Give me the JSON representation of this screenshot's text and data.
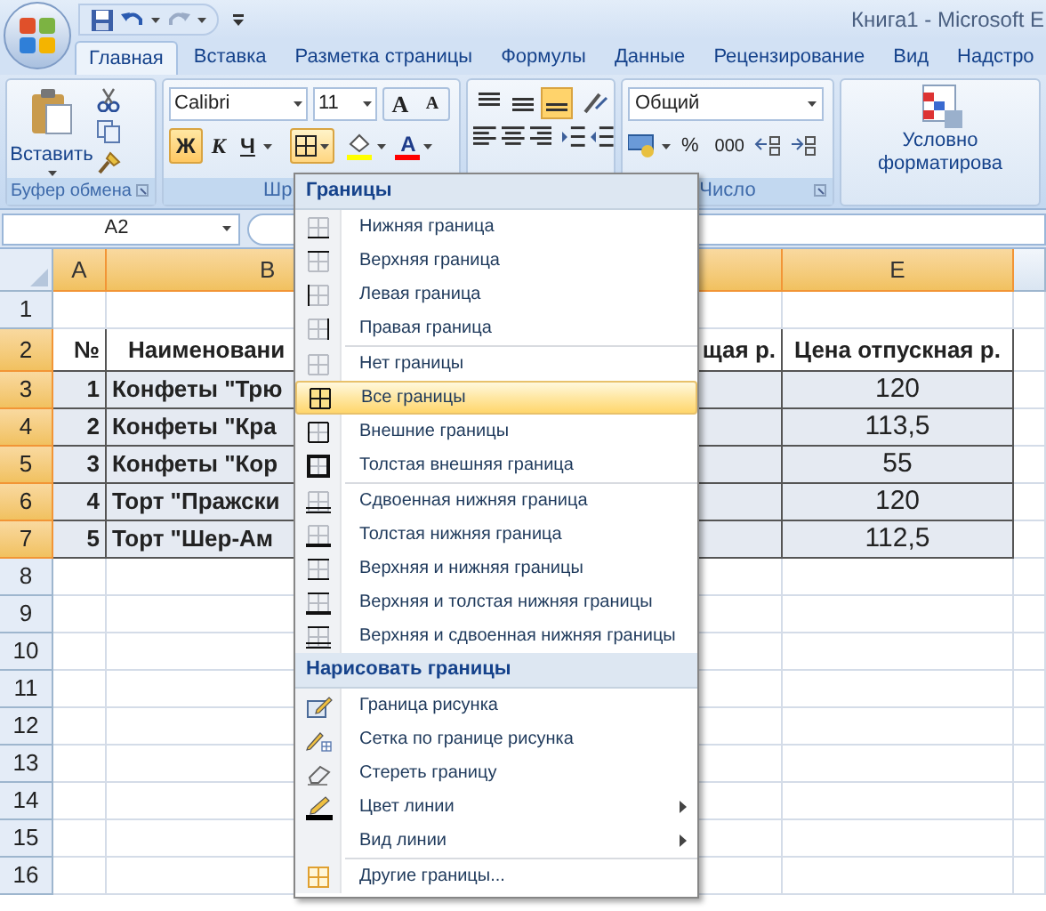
{
  "window": {
    "title": "Книга1 - Microsoft E"
  },
  "tabs": [
    {
      "label": "Главная",
      "selected": true
    },
    {
      "label": "Вставка",
      "selected": false
    },
    {
      "label": "Разметка страницы",
      "selected": false
    },
    {
      "label": "Формулы",
      "selected": false
    },
    {
      "label": "Данные",
      "selected": false
    },
    {
      "label": "Рецензирование",
      "selected": false
    },
    {
      "label": "Вид",
      "selected": false
    },
    {
      "label": "Надстро",
      "selected": false
    }
  ],
  "ribbon": {
    "clipboard": {
      "paste_label": "Вставить",
      "group_label": "Буфер обмена"
    },
    "font": {
      "font_name": "Calibri",
      "font_size": "11",
      "grow_font": "A",
      "shrink_font": "A",
      "bold": {
        "label": "Ж",
        "selected": true
      },
      "italic": {
        "label": "К",
        "selected": false
      },
      "underline": {
        "label": "Ч",
        "selected": false
      },
      "borders": {
        "selected": true
      },
      "font_color": "A",
      "group_label": "Шр"
    },
    "alignment": {
      "bottom_align": {
        "selected": true
      }
    },
    "number": {
      "format": "Общий",
      "percent": "%",
      "thousands": "000",
      "group_label": "Число"
    },
    "styles": {
      "conditional_label": "Условно",
      "conditional_label_2": "форматирова"
    }
  },
  "formula_bar": {
    "name_box": "A2"
  },
  "sheet": {
    "columns": [
      {
        "label": "A",
        "selected": true
      },
      {
        "label": "B",
        "selected": true
      },
      {
        "selected": true
      },
      {
        "label": "E",
        "selected": true
      },
      {
        "selected": false
      }
    ],
    "rows": [
      {
        "label": "1",
        "selected": false,
        "cells": []
      },
      {
        "label": "2",
        "selected": true,
        "cells": [
          "№",
          "Наименовани",
          "щая р.",
          "Цена отпускная р."
        ]
      },
      {
        "label": "3",
        "selected": true,
        "cells": [
          "1",
          "Конфеты \"Трю",
          "",
          "120"
        ]
      },
      {
        "label": "4",
        "selected": true,
        "cells": [
          "2",
          "Конфеты \"Кра",
          "",
          "113,5"
        ]
      },
      {
        "label": "5",
        "selected": true,
        "cells": [
          "3",
          "Конфеты \"Кор",
          "",
          "55"
        ]
      },
      {
        "label": "6",
        "selected": true,
        "cells": [
          "4",
          "Торт \"Пражски",
          "",
          "120"
        ]
      },
      {
        "label": "7",
        "selected": true,
        "cells": [
          "5",
          "Торт \"Шер-Ам",
          "",
          "112,5"
        ]
      },
      {
        "label": "8",
        "selected": false,
        "cells": []
      },
      {
        "label": "9",
        "selected": false,
        "cells": []
      },
      {
        "label": "10",
        "selected": false,
        "cells": []
      },
      {
        "label": "11",
        "selected": false,
        "cells": []
      },
      {
        "label": "12",
        "selected": false,
        "cells": []
      },
      {
        "label": "13",
        "selected": false,
        "cells": []
      },
      {
        "label": "14",
        "selected": false,
        "cells": []
      },
      {
        "label": "15",
        "selected": false,
        "cells": []
      },
      {
        "label": "16",
        "selected": false,
        "cells": []
      }
    ]
  },
  "borders_menu": {
    "sections": [
      {
        "title": "Границы",
        "groups": [
          [
            {
              "label": "Нижняя граница",
              "selected": false
            },
            {
              "label": "Верхняя граница",
              "selected": false
            },
            {
              "label": "Левая граница",
              "selected": false
            },
            {
              "label": "Правая граница",
              "selected": false
            }
          ],
          [
            {
              "label": "Нет границы",
              "selected": false
            },
            {
              "label": "Все границы",
              "selected": true
            },
            {
              "label": "Внешние границы",
              "selected": false
            },
            {
              "label": "Толстая внешняя граница",
              "selected": false
            }
          ],
          [
            {
              "label": "Сдвоенная нижняя граница",
              "selected": false
            },
            {
              "label": "Толстая нижняя граница",
              "selected": false
            },
            {
              "label": "Верхняя и нижняя границы",
              "selected": false
            },
            {
              "label": "Верхняя и толстая нижняя границы",
              "selected": false
            },
            {
              "label": "Верхняя и сдвоенная нижняя границы",
              "selected": false
            }
          ]
        ]
      },
      {
        "title": "Нарисовать границы",
        "groups": [
          [
            {
              "label": "Граница рисунка",
              "selected": false,
              "has_submenu": false
            },
            {
              "label": "Сетка по границе рисунка",
              "selected": false,
              "has_submenu": false
            },
            {
              "label": "Стереть границу",
              "selected": false,
              "has_submenu": false
            },
            {
              "label": "Цвет линии",
              "selected": false,
              "has_submenu": true
            },
            {
              "label": "Вид линии",
              "selected": false,
              "has_submenu": true
            }
          ],
          [
            {
              "label": "Другие границы...",
              "selected": false,
              "has_submenu": false
            }
          ]
        ]
      }
    ]
  }
}
